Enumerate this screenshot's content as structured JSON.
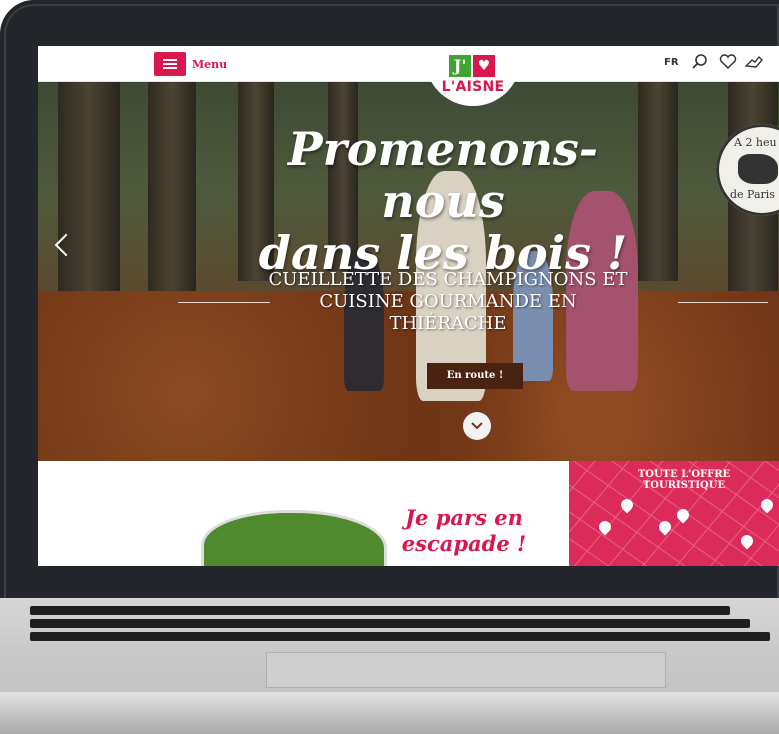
{
  "header": {
    "menu_label": "Menu",
    "logo_letter": "J'",
    "logo_name": "L'AISNE",
    "lang": "FR",
    "icons": [
      "search-icon",
      "heart-icon",
      "hand-icon"
    ]
  },
  "hero": {
    "title_line1": "Promenons-nous",
    "title_line2": "dans les bois !",
    "subtitle": "CUEILLETTE DES CHAMPIGNONS ET CUISINE GOURMANDE EN THIÉRACHE",
    "cta_label": "En route !",
    "stamp_top": "A 2 heu",
    "stamp_bottom": "de Paris"
  },
  "lower": {
    "escapade_text": "Je pars en escapade !",
    "offer_title": "TOUTE L'OFFRE TOURISTIQUE"
  },
  "colors": {
    "brand_pink": "#d9164d",
    "brand_green": "#3ea535",
    "bezel": "#23272b"
  }
}
